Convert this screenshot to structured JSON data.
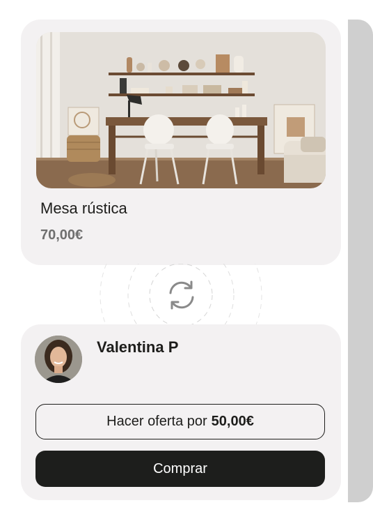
{
  "product": {
    "title": "Mesa rústica",
    "price": "70,00€",
    "image": "rustic-desk-room-photo"
  },
  "swap": {
    "icon": "swap-arrows-icon"
  },
  "seller": {
    "name": "Valentina P",
    "avatar": "seller-avatar-photo"
  },
  "actions": {
    "offer_prefix": "Hacer oferta por",
    "offer_amount": "50,00€",
    "buy_label": "Comprar"
  },
  "colors": {
    "card_bg": "#f3f1f2",
    "dark": "#1d1e1c",
    "muted": "#6f6f6f",
    "side_strip": "#cfcfcf"
  }
}
